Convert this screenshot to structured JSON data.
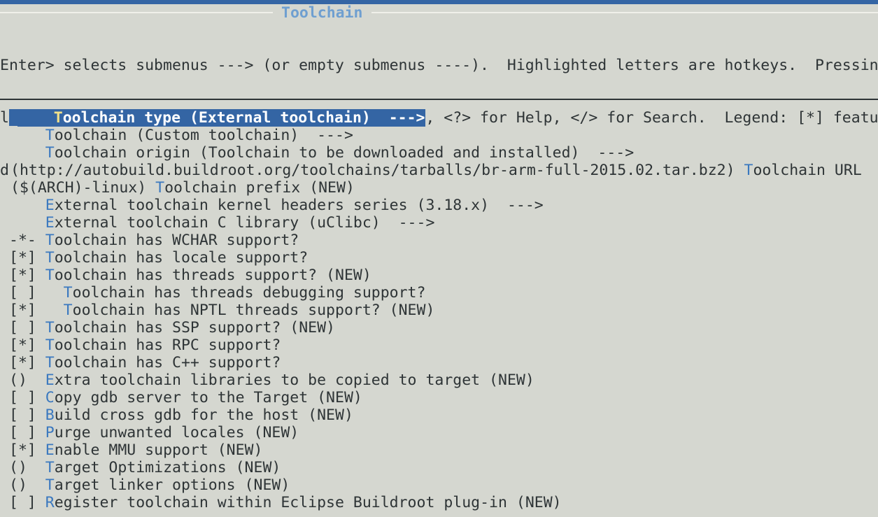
{
  "window": {
    "title": "Toolchain"
  },
  "help": {
    "lines": [
      "Enter> selects submenus ---> (or empty submenus ----).  Highlighted letters are hotkeys.  Pressin",
      "ll exclude a feature.  Press <Esc><Esc> to exit, <?> for Help, </> for Search.  Legend: [*] featu",
      "d"
    ]
  },
  "colors": {
    "background": "#d5d7d0",
    "accent": "#3465a4",
    "hotkey": "#3a78bf",
    "title": "#6f9fd0"
  },
  "menu": {
    "items": [
      {
        "prefix": "    ",
        "hotkey": "T",
        "rest": "oolchain type (External toolchain)  --->",
        "selected": true
      },
      {
        "prefix": "    ",
        "hotkey": "T",
        "rest": "oolchain (Custom toolchain)  --->"
      },
      {
        "prefix": "    ",
        "hotkey": "T",
        "rest": "oolchain origin (Toolchain to be downloaded and installed)  --->"
      },
      {
        "prefix": "(http://autobuild.buildroot.org/toolchains/tarballs/br-arm-full-2015.02.tar.bz2) ",
        "hotkey": "T",
        "rest": "oolchain URL"
      },
      {
        "prefix": "($(ARCH)-linux) ",
        "hotkey": "T",
        "rest": "oolchain prefix (NEW)"
      },
      {
        "prefix": "    ",
        "hotkey": "E",
        "rest": "xternal toolchain kernel headers series (3.18.x)  --->"
      },
      {
        "prefix": "    ",
        "hotkey": "E",
        "rest": "xternal toolchain C library (uClibc)  --->"
      },
      {
        "prefix": "-*- ",
        "hotkey": "T",
        "rest": "oolchain has WCHAR support?"
      },
      {
        "prefix": "[*] ",
        "hotkey": "T",
        "rest": "oolchain has locale support?"
      },
      {
        "prefix": "[*] ",
        "hotkey": "T",
        "rest": "oolchain has threads support? (NEW)"
      },
      {
        "prefix": "[ ]   ",
        "hotkey": "T",
        "rest": "oolchain has threads debugging support?"
      },
      {
        "prefix": "[*]   ",
        "hotkey": "T",
        "rest": "oolchain has NPTL threads support? (NEW)"
      },
      {
        "prefix": "[ ] ",
        "hotkey": "T",
        "rest": "oolchain has SSP support? (NEW)"
      },
      {
        "prefix": "[*] ",
        "hotkey": "T",
        "rest": "oolchain has RPC support?"
      },
      {
        "prefix": "[*] ",
        "hotkey": "T",
        "rest": "oolchain has C++ support?"
      },
      {
        "prefix": "()  ",
        "hotkey": "E",
        "rest": "xtra toolchain libraries to be copied to target (NEW)"
      },
      {
        "prefix": "[ ] ",
        "hotkey": "C",
        "rest": "opy gdb server to the Target (NEW)"
      },
      {
        "prefix": "[ ] ",
        "hotkey": "B",
        "rest": "uild cross gdb for the host (NEW)"
      },
      {
        "prefix": "[ ] ",
        "hotkey": "P",
        "rest": "urge unwanted locales (NEW)"
      },
      {
        "prefix": "[*] ",
        "hotkey": "E",
        "rest": "nable MMU support (NEW)"
      },
      {
        "prefix": "()  ",
        "hotkey": "T",
        "rest": "arget Optimizations (NEW)"
      },
      {
        "prefix": "()  ",
        "hotkey": "T",
        "rest": "arget linker options (NEW)"
      },
      {
        "prefix": "[ ] ",
        "hotkey": "R",
        "rest": "egister toolchain within Eclipse Buildroot plug-in (NEW)"
      }
    ]
  }
}
